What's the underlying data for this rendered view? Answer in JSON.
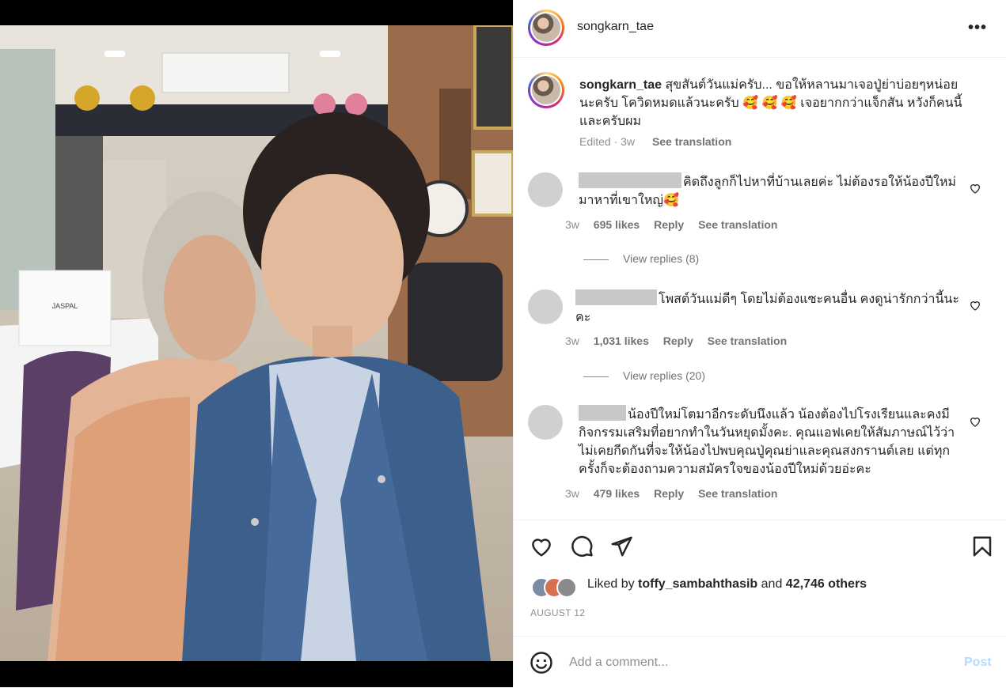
{
  "post": {
    "username": "songkarn_tae",
    "more_icon": "more-horizontal-icon",
    "caption_text": "สุขสันต์วันแม่ครับ... ขอให้หลานมาเจอปู่ย่าบ่อยๆหน่อย นะครับ โควิดหมดแล้วนะครับ 🥰 🥰 🥰  เจอยากกว่าแจ็กสัน หวังก็คนนี้ และครับผม",
    "caption_edited": "Edited · 3w",
    "caption_translate": "See translation"
  },
  "photo": {
    "bag_label": "JASPAL"
  },
  "comments": [
    {
      "text": "คิดถึงลูกก็ไปหาที่บ้านเลยค่ะ ไม่ต้องรอให้น้องปีใหม่มาหาที่เขาใหญ่🥰",
      "time": "3w",
      "likes": "695 likes",
      "reply": "Reply",
      "translate": "See translation",
      "view_replies": "View replies (8)"
    },
    {
      "text": "โพสต์วันแม่ดีๆ โดยไม่ต้องแซะคนอื่น คงดูน่ารักกว่านี้นะคะ",
      "time": "3w",
      "likes": "1,031 likes",
      "reply": "Reply",
      "translate": "See translation",
      "view_replies": "View replies (20)"
    },
    {
      "text": "น้องปีใหม่โตมาอีกระดับนึงแล้ว น้องต้องไปโรงเรียนและคงมีกิจกรรมเสริมที่อยากทำในวันหยุดมั้งคะ. คุณแอฟเคยให้สัมภาษณ์ไว้ว่าไม่เคยกีดกันที่จะให้น้องไปพบคุณปู่คุณย่าและคุณสงกรานต์เลย แต่ทุกครั้งก็จะต้องถามความสมัครใจของน้องปีใหม่ด้วยอ่ะคะ",
      "time": "3w",
      "likes": "479 likes",
      "reply": "Reply",
      "translate": "See translation"
    }
  ],
  "footer": {
    "liked_prefix": "Liked by",
    "liked_user": "toffy_sambahthasib",
    "liked_and": "and",
    "liked_others": "42,746 others",
    "date": "AUGUST 12",
    "comment_placeholder": "Add a comment...",
    "post_label": "Post"
  },
  "colors": {
    "accent_disabled": "#b3dbff",
    "muted": "#8e8e8e",
    "text": "#262626"
  }
}
